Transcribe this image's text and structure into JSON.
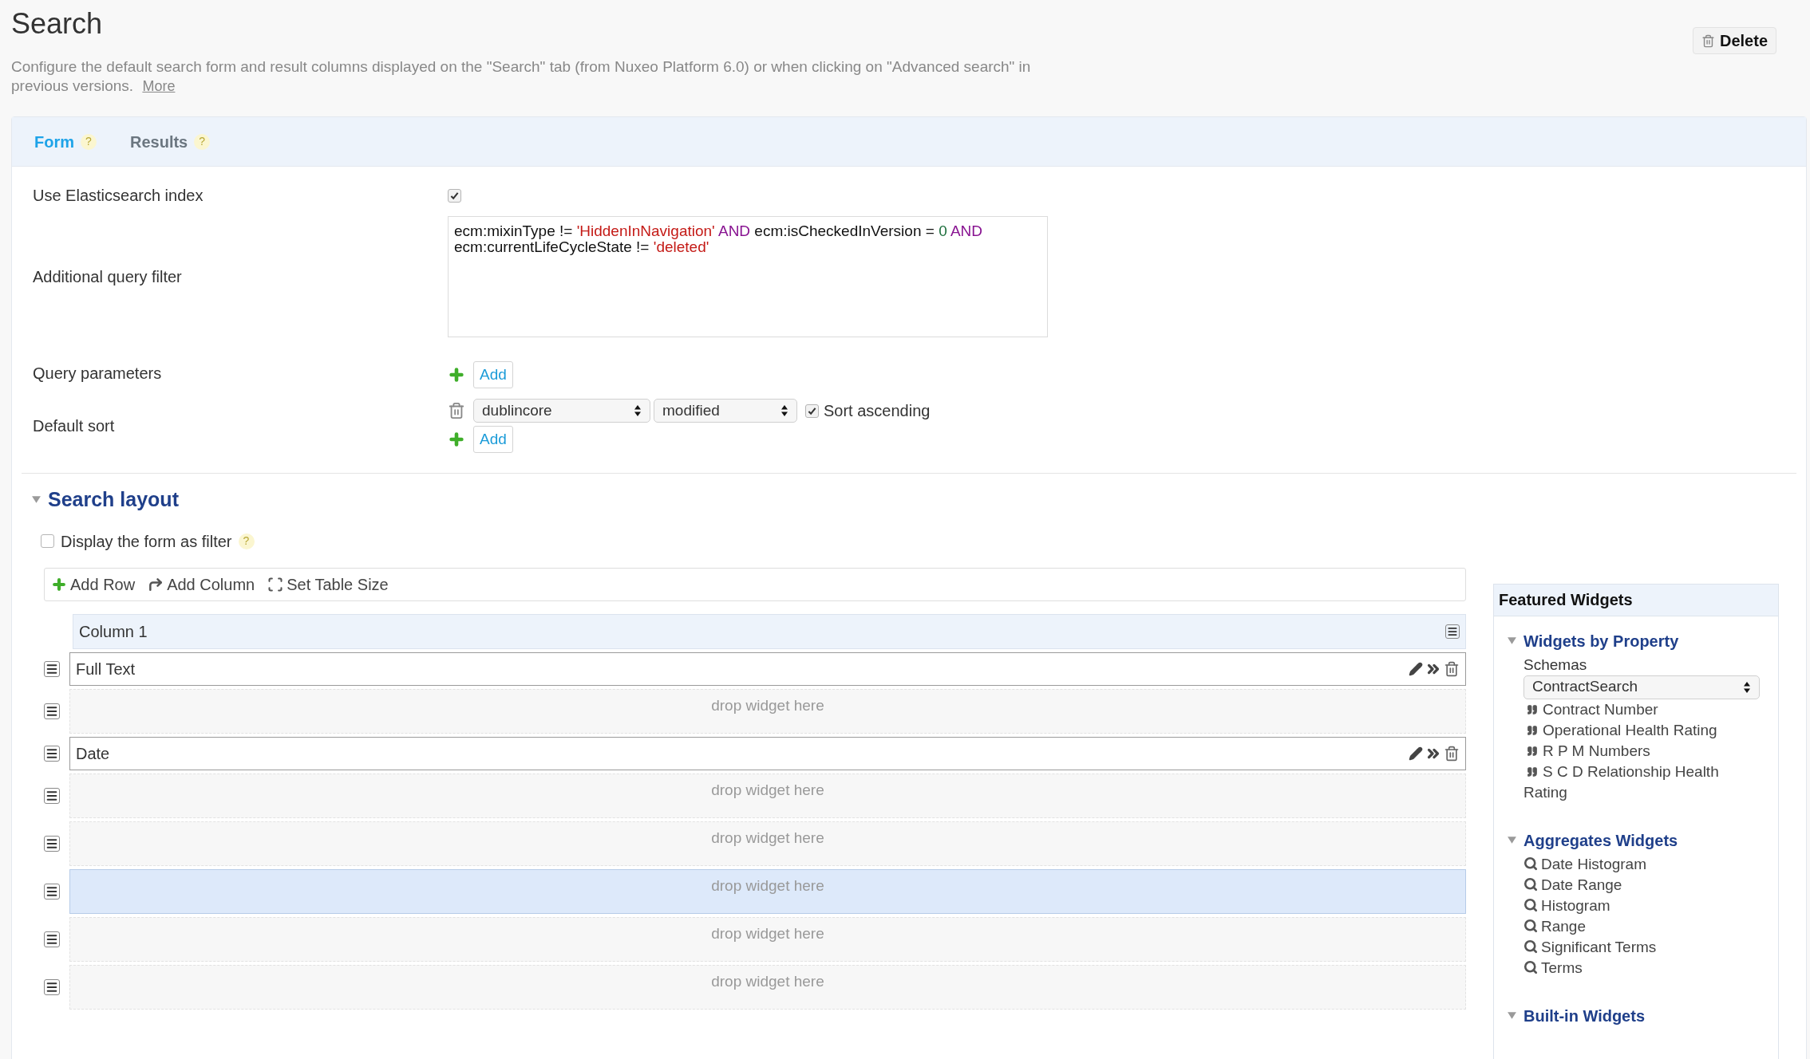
{
  "header": {
    "title": "Search",
    "description": "Configure the default search form and result columns displayed on the \"Search\" tab (from Nuxeo Platform 6.0) or when clicking on \"Advanced search\" in previous versions.",
    "more_link": "More",
    "delete_button": "Delete"
  },
  "tabs": [
    {
      "label": "Form",
      "help": "?",
      "selected": true
    },
    {
      "label": "Results",
      "help": "?",
      "selected": false
    }
  ],
  "form": {
    "elasticsearch": {
      "label": "Use Elasticsearch index",
      "checked": true
    },
    "query_filter": {
      "label": "Additional query filter",
      "segments": [
        {
          "kind": "plain",
          "text": "ecm:mixinType != "
        },
        {
          "kind": "string",
          "text": "'HiddenInNavigation'"
        },
        {
          "kind": "keyword",
          "text": " AND"
        },
        {
          "kind": "plain",
          "text": " ecm:isCheckedInVersion = "
        },
        {
          "kind": "number",
          "text": "0"
        },
        {
          "kind": "keyword",
          "text": " AND"
        },
        {
          "kind": "plain",
          "text": " ecm:currentLifeCycleState != "
        },
        {
          "kind": "string",
          "text": "'deleted'"
        }
      ]
    },
    "query_parameters": {
      "label": "Query parameters",
      "add_button": "Add"
    },
    "default_sort": {
      "label": "Default sort",
      "schema": "dublincore",
      "field": "modified",
      "ascending": {
        "label": "Sort ascending",
        "checked": true
      },
      "add_button": "Add"
    }
  },
  "layout": {
    "title": "Search layout",
    "expanded": true,
    "display_as_filter": {
      "label": "Display the form as filter",
      "help": "?",
      "checked": false
    },
    "toolbar": [
      "Add Row",
      "Add Column",
      "Set Table Size"
    ],
    "column_header": "Column 1",
    "rows": [
      {
        "kind": "widget",
        "label": "Full Text"
      },
      {
        "kind": "drop",
        "label": "drop widget here",
        "highlighted": false
      },
      {
        "kind": "widget",
        "label": "Date"
      },
      {
        "kind": "drop",
        "label": "drop widget here",
        "highlighted": false
      },
      {
        "kind": "drop",
        "label": "drop widget here",
        "highlighted": false
      },
      {
        "kind": "drop",
        "label": "drop widget here",
        "highlighted": true
      },
      {
        "kind": "drop",
        "label": "drop widget here",
        "highlighted": false
      },
      {
        "kind": "drop",
        "label": "drop widget here",
        "highlighted": false
      }
    ]
  },
  "featured_widgets": {
    "title": "Featured Widgets",
    "groups": [
      {
        "title": "Widgets by Property",
        "expanded": true,
        "kind": "property",
        "schema_label": "Schemas",
        "schema": "ContractSearch",
        "items": [
          "Contract Number",
          "Operational Health Rating",
          "R P M Numbers",
          "S C D Relationship Health Rating"
        ]
      },
      {
        "title": "Aggregates Widgets",
        "expanded": true,
        "kind": "aggregate",
        "items": [
          "Date Histogram",
          "Date Range",
          "Histogram",
          "Range",
          "Significant Terms",
          "Terms"
        ]
      },
      {
        "title": "Built-in Widgets",
        "expanded": true
      }
    ]
  }
}
